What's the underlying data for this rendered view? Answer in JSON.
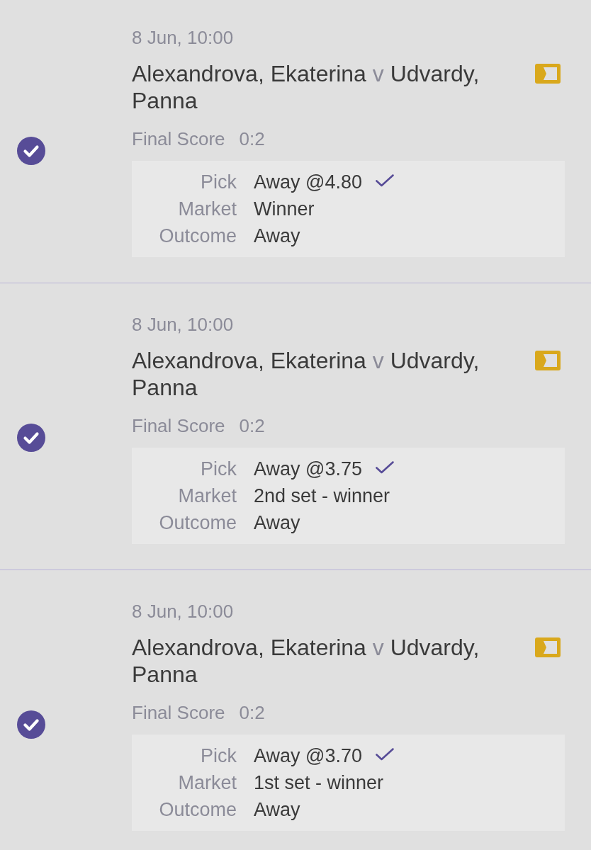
{
  "bets": [
    {
      "settled": true,
      "date": "8 Jun, 10:00",
      "home": "Alexandrova, Ekaterina",
      "separator": "v",
      "away": "Udvardy, Panna",
      "score_label": "Final Score",
      "score": "0:2",
      "pick": {
        "label": "Pick",
        "value": "Away @4.80",
        "won": true
      },
      "market": {
        "label": "Market",
        "value": "Winner"
      },
      "outcome": {
        "label": "Outcome",
        "value": "Away"
      }
    },
    {
      "settled": true,
      "date": "8 Jun, 10:00",
      "home": "Alexandrova, Ekaterina",
      "separator": "v",
      "away": "Udvardy, Panna",
      "score_label": "Final Score",
      "score": "0:2",
      "pick": {
        "label": "Pick",
        "value": "Away @3.75",
        "won": true
      },
      "market": {
        "label": "Market",
        "value": "2nd set - winner"
      },
      "outcome": {
        "label": "Outcome",
        "value": "Away"
      }
    },
    {
      "settled": true,
      "date": "8 Jun, 10:00",
      "home": "Alexandrova, Ekaterina",
      "separator": "v",
      "away": "Udvardy, Panna",
      "score_label": "Final Score",
      "score": "0:2",
      "pick": {
        "label": "Pick",
        "value": "Away @3.70",
        "won": true
      },
      "market": {
        "label": "Market",
        "value": "1st set - winner"
      },
      "outcome": {
        "label": "Outcome",
        "value": "Away"
      }
    }
  ]
}
